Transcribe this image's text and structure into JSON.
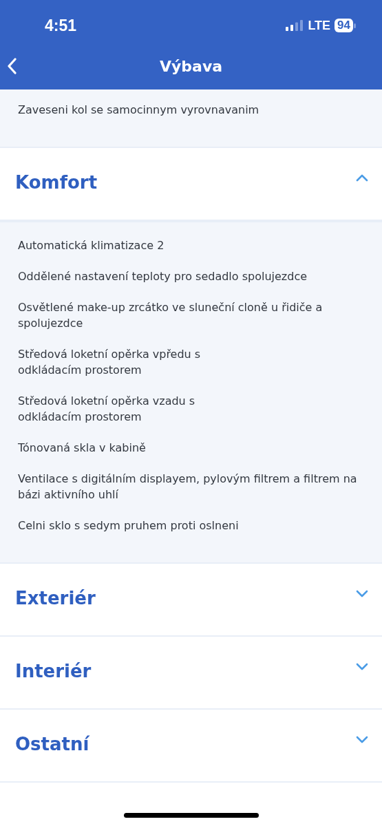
{
  "status_bar": {
    "time": "4:51",
    "network": "LTE",
    "battery": "94"
  },
  "nav_bar": {
    "title": "Výbava"
  },
  "top_items": [
    "Zaveseni kol se samocinnym vyrovnavanim"
  ],
  "sections": [
    {
      "title": "Komfort",
      "expanded": true,
      "items": [
        "Automatická klimatizace 2",
        "Oddělené nastavení teploty pro sedadlo spolujezdce",
        "Osvětlené make-up zrcátko ve sluneční cloně u řidiče a spolujezdce",
        "Středová loketní opěrka vpředu s\nodkládacím prostorem",
        "Středová loketní opěrka vzadu s\nodkládacím prostorem",
        "Tónovaná skla v kabině",
        "Ventilace s digitálním displayem, pylovým filtrem a filtrem na bázi aktivního uhlí",
        "Celni sklo s sedym pruhem proti oslneni"
      ]
    },
    {
      "title": "Exteriér",
      "expanded": false
    },
    {
      "title": "Interiér",
      "expanded": false
    },
    {
      "title": "Ostatní",
      "expanded": false
    }
  ]
}
